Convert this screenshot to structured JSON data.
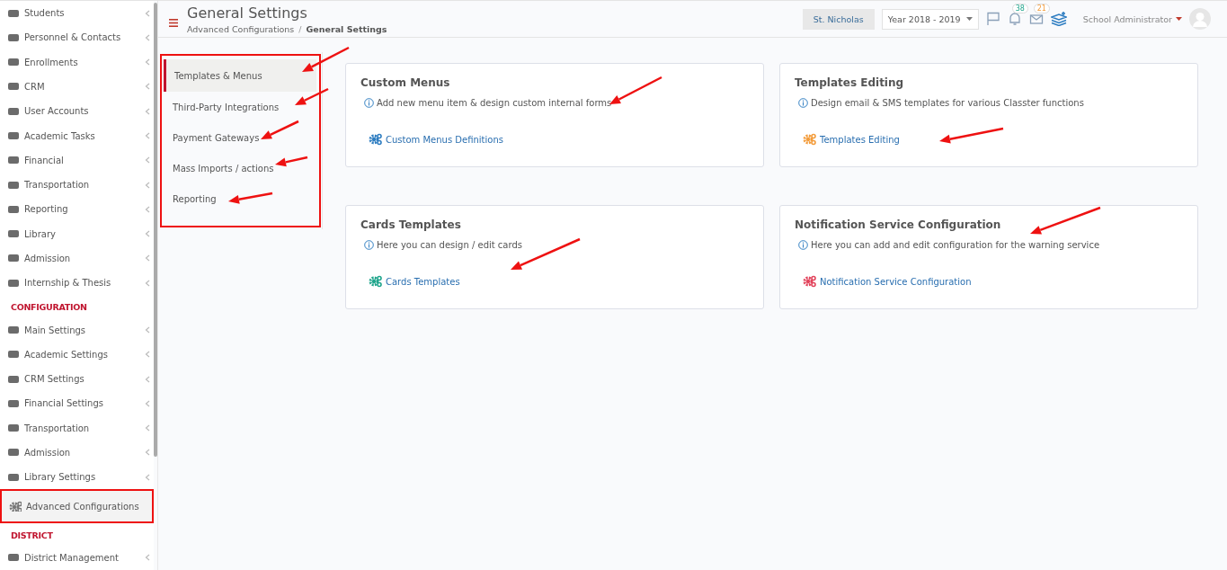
{
  "sidebar": {
    "items": [
      {
        "kind": "item",
        "label": "Students",
        "expandable": true,
        "selected": false,
        "highlighted": false
      },
      {
        "kind": "item",
        "label": "Personnel & Contacts",
        "expandable": true,
        "selected": false,
        "highlighted": false
      },
      {
        "kind": "item",
        "label": "Enrollments",
        "expandable": true,
        "selected": false,
        "highlighted": false
      },
      {
        "kind": "item",
        "label": "CRM",
        "expandable": true,
        "selected": false,
        "highlighted": false
      },
      {
        "kind": "item",
        "label": "User Accounts",
        "expandable": true,
        "selected": false,
        "highlighted": false
      },
      {
        "kind": "item",
        "label": "Academic Tasks",
        "expandable": true,
        "selected": false,
        "highlighted": false
      },
      {
        "kind": "item",
        "label": "Financial",
        "expandable": true,
        "selected": false,
        "highlighted": false
      },
      {
        "kind": "item",
        "label": "Transportation",
        "expandable": true,
        "selected": false,
        "highlighted": false
      },
      {
        "kind": "item",
        "label": "Reporting",
        "expandable": true,
        "selected": false,
        "highlighted": false
      },
      {
        "kind": "item",
        "label": "Library",
        "expandable": true,
        "selected": false,
        "highlighted": false
      },
      {
        "kind": "item",
        "label": "Admission",
        "expandable": true,
        "selected": false,
        "highlighted": false
      },
      {
        "kind": "item",
        "label": "Internship & Thesis",
        "expandable": true,
        "selected": false,
        "highlighted": false
      },
      {
        "kind": "heading",
        "label": "CONFIGURATION"
      },
      {
        "kind": "item",
        "label": "Main Settings",
        "expandable": true,
        "selected": false,
        "highlighted": false
      },
      {
        "kind": "item",
        "label": "Academic Settings",
        "expandable": true,
        "selected": false,
        "highlighted": false
      },
      {
        "kind": "item",
        "label": "CRM Settings",
        "expandable": true,
        "selected": false,
        "highlighted": false
      },
      {
        "kind": "item",
        "label": "Financial Settings",
        "expandable": true,
        "selected": false,
        "highlighted": false
      },
      {
        "kind": "item",
        "label": "Transportation",
        "expandable": true,
        "selected": false,
        "highlighted": false
      },
      {
        "kind": "item",
        "label": "Admission",
        "expandable": true,
        "selected": false,
        "highlighted": false
      },
      {
        "kind": "item",
        "label": "Library Settings",
        "expandable": true,
        "selected": false,
        "highlighted": false
      },
      {
        "kind": "item",
        "label": "Advanced Configurations",
        "expandable": false,
        "selected": true,
        "highlighted": true
      },
      {
        "kind": "heading",
        "label": "DISTRICT"
      },
      {
        "kind": "item",
        "label": "District Management",
        "expandable": true,
        "selected": false,
        "highlighted": false
      }
    ]
  },
  "header": {
    "title": "General Settings",
    "breadcrumb": [
      "Advanced Configurations",
      "General Settings"
    ],
    "breadcrumb_separator": "/",
    "school": "St. Nicholas",
    "year": "Year 2018 - 2019",
    "notifications": "38",
    "messages": "21",
    "user": "School Administrator"
  },
  "submenu": {
    "highlighted": true,
    "items": [
      {
        "label": "Templates & Menus",
        "selected": true
      },
      {
        "label": "Third-Party Integrations",
        "selected": false
      },
      {
        "label": "Payment Gateways",
        "selected": false
      },
      {
        "label": "Mass Imports / actions",
        "selected": false
      },
      {
        "label": "Reporting",
        "selected": false
      }
    ]
  },
  "cards": [
    {
      "title": "Custom Menus",
      "info": "Add new menu item & design custom internal forms",
      "link": "Custom Menus Definitions",
      "color": "#2e7dc1"
    },
    {
      "title": "Templates Editing",
      "info": "Design email & SMS templates for various Classter functions",
      "link": "Templates Editing",
      "color": "#f39c3b"
    },
    {
      "title": "Cards Templates",
      "info": "Here you can design / edit cards",
      "link": "Cards Templates",
      "color": "#1fa58c"
    },
    {
      "title": "Notification Service Configuration",
      "info": "Here you can add and edit configuration for the warning service",
      "link": "Notification Service Configuration",
      "color": "#e2445c"
    }
  ]
}
